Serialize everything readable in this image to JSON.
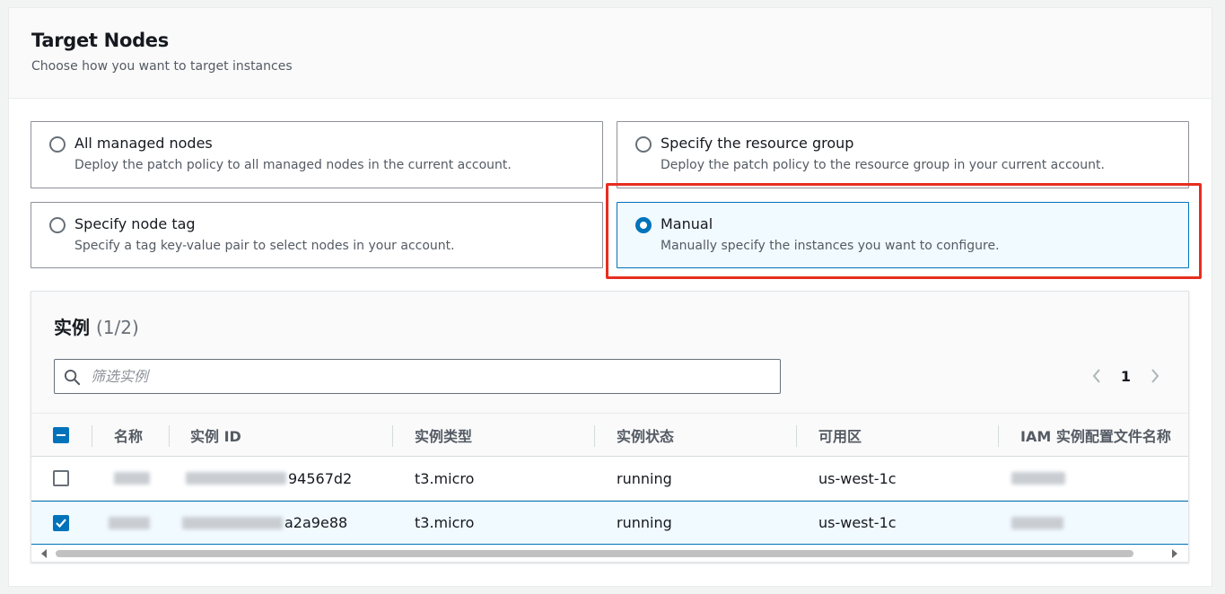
{
  "section": {
    "title": "Target Nodes",
    "description": "Choose how you want to target instances"
  },
  "options": [
    {
      "title": "All managed nodes",
      "description": "Deploy the patch policy to all managed nodes in the current account.",
      "selected": false
    },
    {
      "title": "Specify the resource group",
      "description": "Deploy the patch policy to the resource group in your current account.",
      "selected": false
    },
    {
      "title": "Specify node tag",
      "description": "Specify a tag key-value pair to select nodes in your account.",
      "selected": false
    },
    {
      "title": "Manual",
      "description": "Manually specify the instances you want to configure.",
      "selected": true
    }
  ],
  "instances": {
    "title": "实例",
    "count": "(1/2)",
    "search_placeholder": "筛选实例",
    "current_page": "1",
    "columns": [
      "名称",
      "实例 ID",
      "实例类型",
      "实例状态",
      "可用区",
      "IAM 实例配置文件名称"
    ],
    "rows": [
      {
        "selected": false,
        "id_suffix": "94567d2",
        "type": "t3.micro",
        "state": "running",
        "az": "us-west-1c"
      },
      {
        "selected": true,
        "id_suffix": "a2a9e88",
        "type": "t3.micro",
        "state": "running",
        "az": "us-west-1c"
      }
    ]
  },
  "colors": {
    "accent": "#0073bb",
    "highlight": "#e62e1f",
    "selected_bg": "#f1faff"
  }
}
